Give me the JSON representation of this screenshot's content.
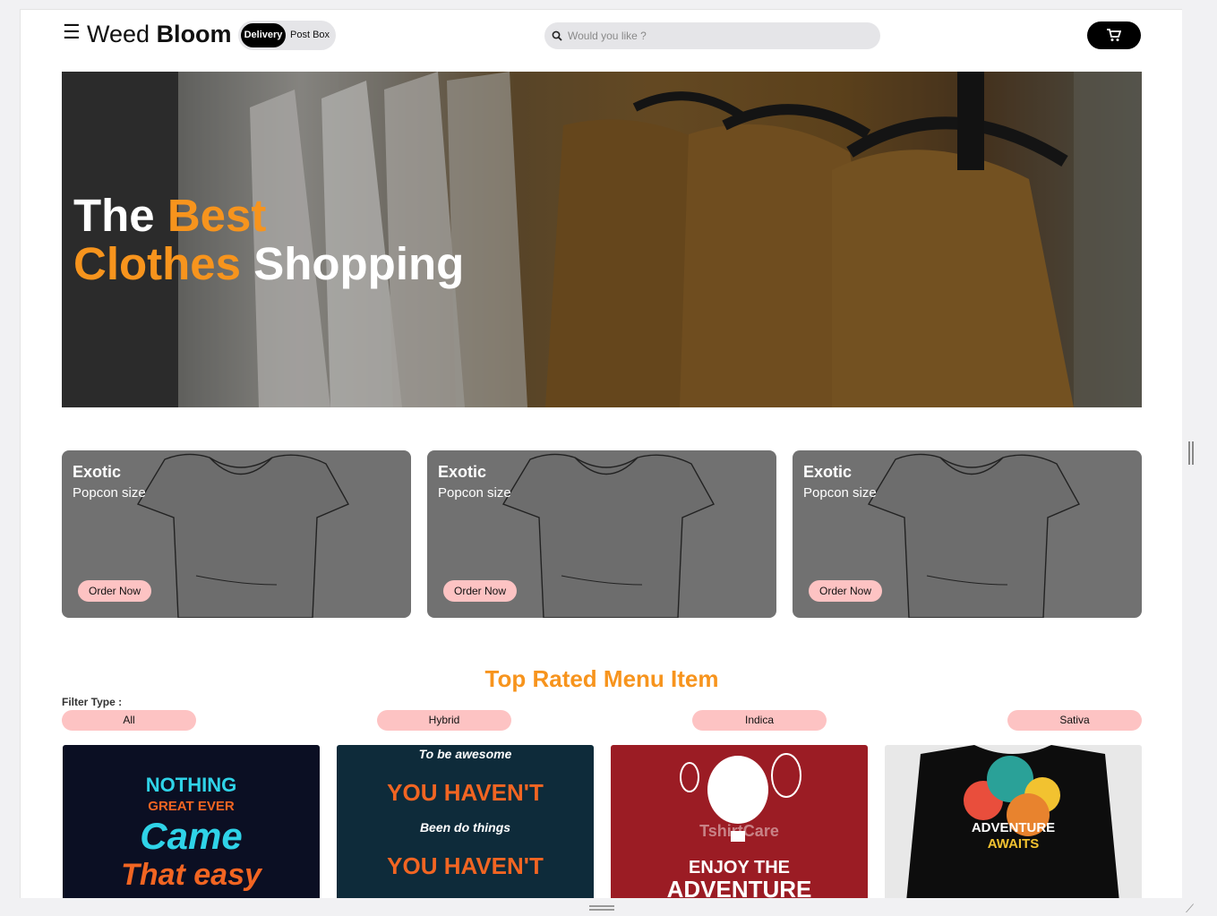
{
  "header": {
    "brand_light": "Weed",
    "brand_bold": "Bloom",
    "toggle": {
      "active": "Delivery",
      "inactive": "Post Box"
    },
    "search_placeholder": "Would you like ?"
  },
  "hero": {
    "line1_white": "The",
    "line1_orange": "Best",
    "line2_orange": "Clothes",
    "line2_white": "Shopping"
  },
  "promos": [
    {
      "title": "Exotic",
      "subtitle": "Popcon size",
      "button": "Order Now"
    },
    {
      "title": "Exotic",
      "subtitle": "Popcon size",
      "button": "Order Now"
    },
    {
      "title": "Exotic",
      "subtitle": "Popcon size",
      "button": "Order Now"
    }
  ],
  "section": {
    "title": "Top Rated Menu Item",
    "filter_label": "Filter Type :",
    "filters": [
      "All",
      "Hybrid",
      "Indica",
      "Sativa"
    ]
  },
  "products": [
    {
      "lines": [
        "NOTHING",
        "GREAT EVER",
        "Came",
        "That easy"
      ]
    },
    {
      "lines": [
        "To be awesome",
        "YOU HAVEN'T",
        "Been do things",
        "YOU HAVEN'T"
      ]
    },
    {
      "lines": [
        "TshirtCare",
        "ENJOY THE",
        "ADVENTURE"
      ]
    },
    {
      "lines": [
        "ADVENTURE",
        "AWAITS"
      ]
    }
  ],
  "colors": {
    "accent": "#f7941d",
    "chip": "#fdc3c3",
    "card": "#717171"
  }
}
